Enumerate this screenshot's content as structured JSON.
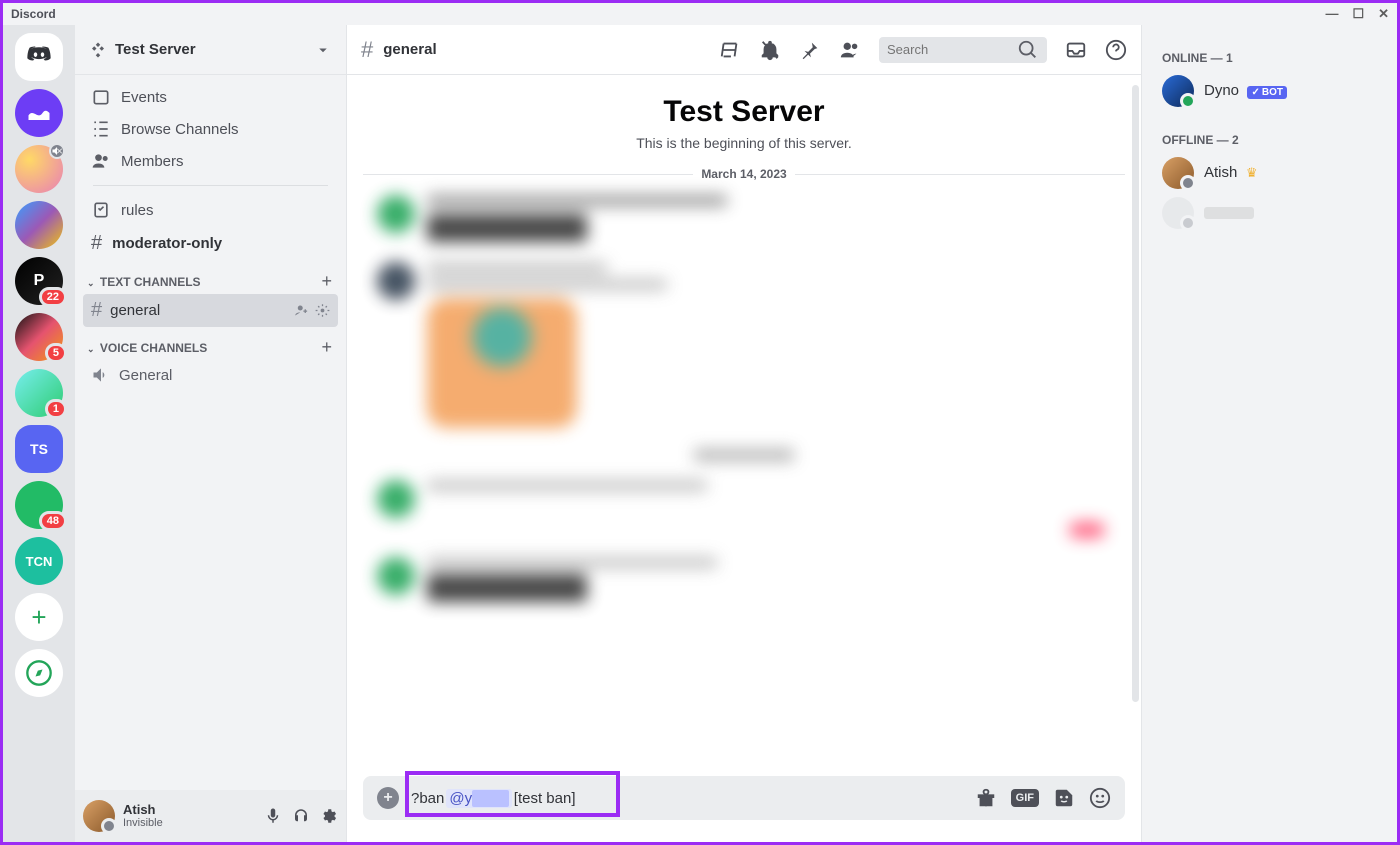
{
  "app": {
    "title": "Discord"
  },
  "server_rail": {
    "items": [
      {
        "name": "dm-home",
        "label": ""
      },
      {
        "name": "server-wave",
        "label": ""
      },
      {
        "name": "server-sail",
        "label": "",
        "muted": true
      },
      {
        "name": "server-wizard",
        "label": ""
      },
      {
        "name": "server-p",
        "label": "P",
        "badge": "22"
      },
      {
        "name": "server-tri",
        "label": "",
        "badge": "5"
      },
      {
        "name": "server-chart",
        "label": "",
        "badge": "1"
      },
      {
        "name": "server-ts",
        "label": "TS"
      },
      {
        "name": "server-green",
        "label": "",
        "badge": "48"
      },
      {
        "name": "server-tcn",
        "label": "TCN"
      }
    ],
    "add": "+",
    "explore": "✦"
  },
  "server_header": {
    "name": "Test Server"
  },
  "sidebar": {
    "top": [
      {
        "icon": "calendar",
        "label": "Events"
      },
      {
        "icon": "browse",
        "label": "Browse Channels"
      },
      {
        "icon": "members",
        "label": "Members"
      }
    ],
    "special": [
      {
        "icon": "rules",
        "label": "rules"
      },
      {
        "icon": "hash",
        "label": "moderator-only",
        "bold": true,
        "hash": "#"
      }
    ],
    "text_cat_label": "Text Channels",
    "text_channels": [
      {
        "label": "general",
        "active": true
      }
    ],
    "voice_cat_label": "Voice Channels",
    "voice_channels": [
      {
        "label": "General"
      }
    ]
  },
  "user_footer": {
    "name": "Atish",
    "status": "Invisible"
  },
  "chat": {
    "channel_hash": "#",
    "channel_name": "general",
    "welcome_title": "Test Server",
    "welcome_subtitle": "This is the beginning of this server.",
    "date": "March 14, 2023",
    "search_placeholder": "Search",
    "input": {
      "prefix": "?ban ",
      "mention": "@y",
      "suffix": " [test ban]"
    }
  },
  "members": {
    "online_label": "Online — 1",
    "offline_label": "Offline — 2",
    "list": [
      {
        "name": "Dyno",
        "bot": true,
        "bot_label": "BOT"
      },
      {
        "name": "Atish",
        "owner": true
      }
    ]
  }
}
